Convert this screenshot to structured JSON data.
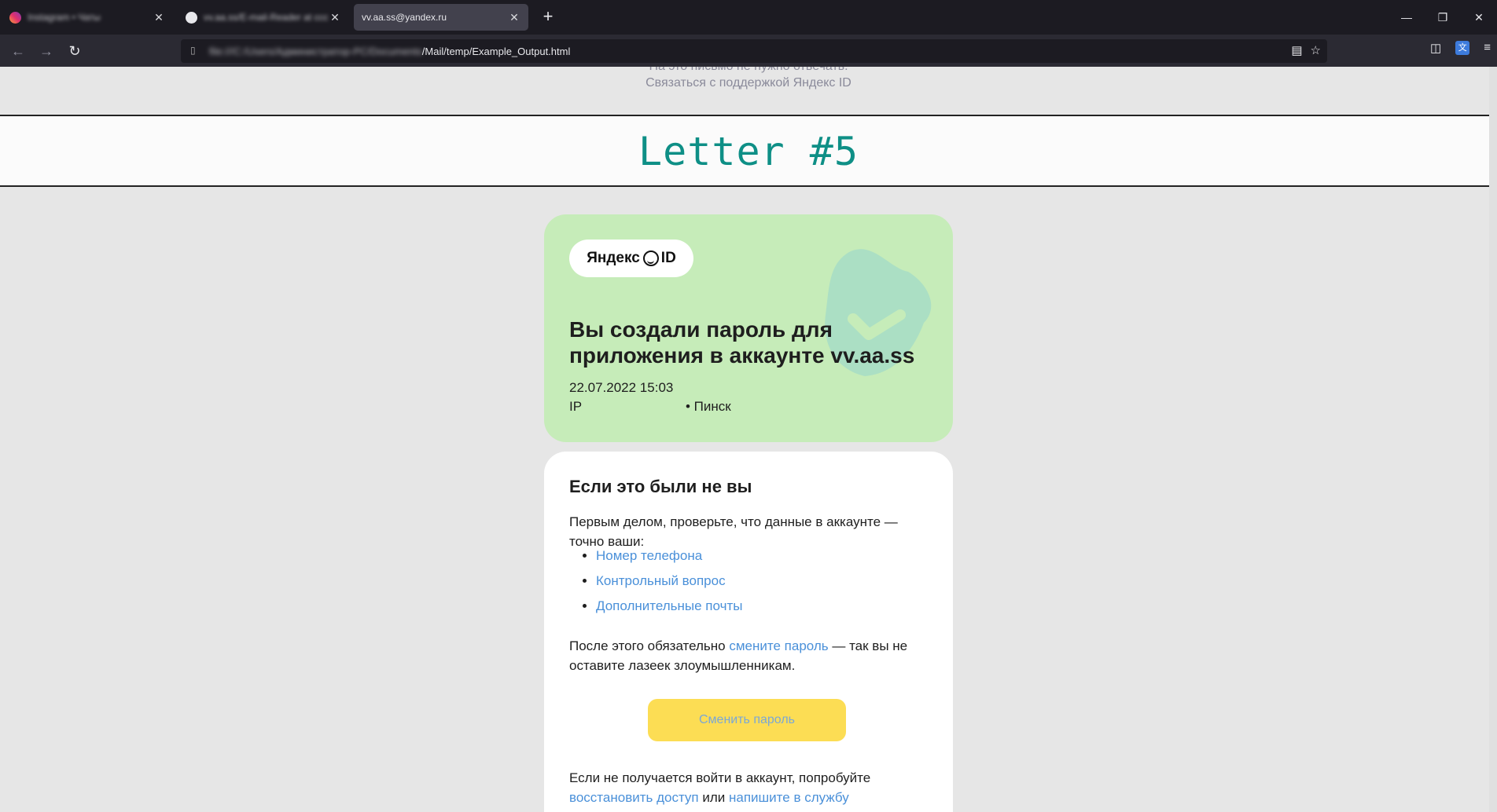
{
  "browser": {
    "tabs": [
      {
        "title": "Instagram • Чаты",
        "favicon_color": "#e1306c",
        "active": false
      },
      {
        "title": "vv.aa.ss/E-mail-Reader at ccc",
        "favicon_color": "#e8e8ec",
        "active": false
      },
      {
        "title": "vv.aa.ss@yandex.ru",
        "favicon_color": "",
        "active": true
      }
    ],
    "new_tab": "+",
    "window_controls": {
      "minimize": "—",
      "restore": "❐",
      "close": "✕"
    },
    "nav": {
      "back": "←",
      "forward": "→",
      "reload": "↻"
    },
    "url_blurred": "file:///C:/Users/Администратор-PC/Documents",
    "url_visible": "/Mail/temp/Example_Output.html",
    "url_icons": {
      "reader": "▤",
      "bookmark": "☆"
    },
    "tool_icons": {
      "pocket": "◫",
      "translate": "文",
      "menu": "≡"
    }
  },
  "previous_letter_footer": {
    "cut_text": "На это письмо не нужно отвечать.",
    "support_link": "Связаться с поддержкой Яндекс ID"
  },
  "letter_header": {
    "title": "Letter #5"
  },
  "email": {
    "logo_left": "Яндекс",
    "logo_right": "ID",
    "headline": "Вы создали пароль для приложения в аккаунте vv.aa.ss",
    "datetime": "22.07.2022 15:03",
    "ip_label": "IP",
    "city": "• Пинск",
    "section_title": "Если это были не вы",
    "intro": "Первым делом, проверьте, что данные в аккаунте — точно ваши:",
    "links": [
      "Номер телефона",
      "Контрольный вопрос",
      "Дополнительные почты"
    ],
    "after_prefix": "После этого обязательно ",
    "after_link": "смените пароль",
    "after_suffix": " — так вы не оставите лазеек злоумышленникам.",
    "button": "Сменить пароль",
    "recover_prefix": "Если не получается войти в аккаунт, попробуйте ",
    "recover_link": "восстановить доступ",
    "recover_mid": " или ",
    "support_link": "напишите в службу"
  },
  "colors": {
    "green_card": "#c6ecb9",
    "button": "#fcdd54",
    "link": "#4a90d9",
    "letter_title": "#0e8f86"
  }
}
